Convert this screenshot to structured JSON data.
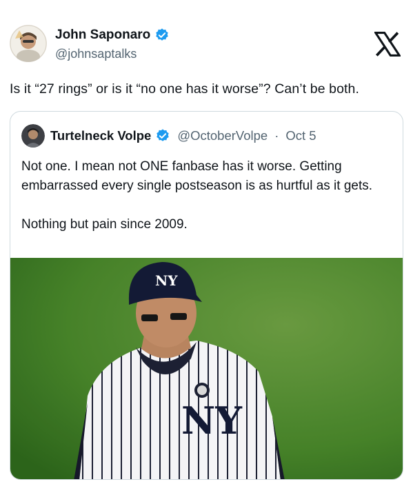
{
  "tweet": {
    "author": {
      "name": "John Saponaro",
      "handle": "@johnsaptalks",
      "verified_color": "#1d9bf0"
    },
    "text": "Is it “27 rings” or is it “no one has it worse”? Can’t be both.",
    "quoted": {
      "author": {
        "name": "Turtelneck Volpe",
        "handle": "@OctoberVolpe",
        "separator": "·",
        "date": "Oct 5"
      },
      "paragraphs": [
        "Not one. I mean not ONE fanbase has it worse. Getting embarrassed every single postseason is as hurtful as it gets.",
        "Nothing but pain since 2009."
      ],
      "image": {
        "cap_logo": "NY",
        "jersey_logo": "NY"
      }
    }
  },
  "icons": [
    "x-logo-icon",
    "verified-badge-icon"
  ]
}
